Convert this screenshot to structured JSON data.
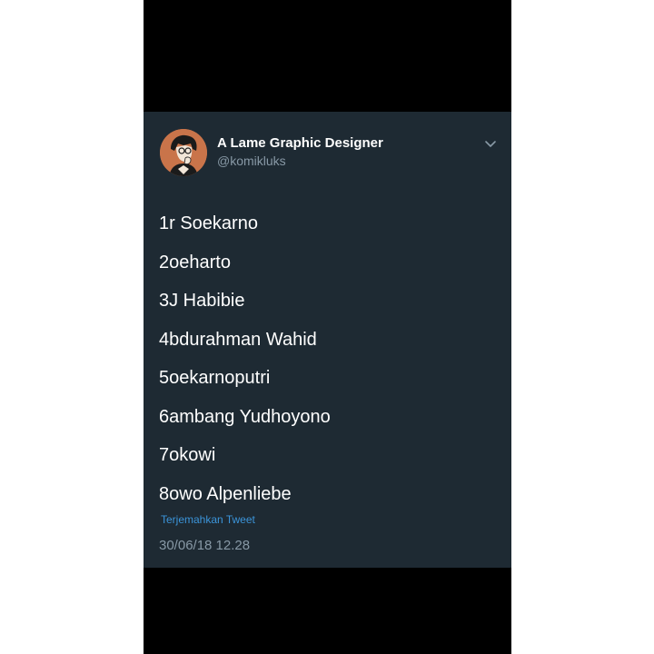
{
  "tweet": {
    "display_name": "A Lame Graphic Designer",
    "handle": "@komikluks",
    "menu_icon": "chevron-down-icon",
    "lines": [
      "1r Soekarno",
      "2oeharto",
      "3J Habibie",
      "4bdurahman Wahid",
      "5oekarnoputri",
      "6ambang Yudhoyono",
      "7okowi",
      "8owo Alpenliebe"
    ],
    "translate_link": "Terjemahkan Tweet",
    "timestamp": "30/06/18 12.28"
  },
  "colors": {
    "card_background": "#1e2a33",
    "outer_background": "#000000",
    "avatar_background": "#c9744a",
    "link_blue": "#3b94d9",
    "muted_text": "#8899a6"
  }
}
